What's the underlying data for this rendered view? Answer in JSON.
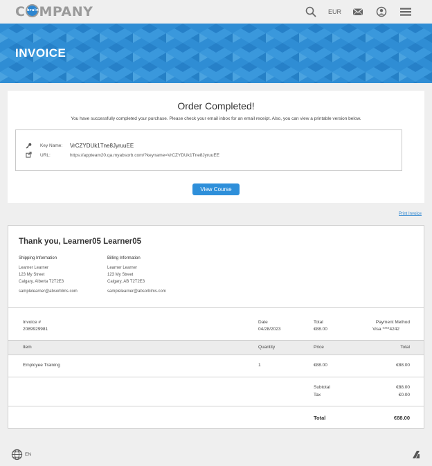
{
  "header": {
    "brand": "C",
    "brand_rest": "MPANY",
    "brand_badge": "brain",
    "currency": "EUR",
    "icons": [
      "search-icon",
      "mail-icon",
      "user-icon",
      "menu-icon"
    ]
  },
  "banner": {
    "title": "INVOICE",
    "color": "#2c8bd3"
  },
  "order": {
    "title": "Order Completed!",
    "message": "You have successfully completed your purchase. Please check your email inbox for an email receipt. Also, you can view a printable version below.",
    "key_name_label": "Key Name:",
    "key_name_value": "VrCZYDUk1Tne8JyruuEE",
    "url_label": "URL:",
    "url_value": "https://appteam20.qa.myabsorb.com/?keyname=VrCZYDUk1Tne8JyruuEE",
    "view_course_label": "View Course"
  },
  "print_invoice_label": "Print Invoice",
  "invoice": {
    "thanks": "Thank you, Learner05 Learner05",
    "shipping": {
      "heading": "Shipping Information",
      "lines": [
        "Learner Learner",
        "123 My Street",
        "Calgary, Alberta T2T2E3"
      ],
      "email": "samplelearner@absorblms.com"
    },
    "billing": {
      "heading": "Billing Information",
      "lines": [
        "Learner Learner",
        "123 My Street",
        "Calgary, AB T2T2E3"
      ],
      "email": "samplelearner@absorblms.com"
    },
    "summary": {
      "invoice_label": "Invoice #",
      "invoice_value": "2089929981",
      "date_label": "Date",
      "date_value": "04/28/2023",
      "total_label": "Total",
      "total_value": "€88.00",
      "payment_label": "Payment Method",
      "payment_value": "Visa ****4242"
    },
    "columns": {
      "item": "Item",
      "quantity": "Quantity",
      "price": "Price",
      "total": "Total"
    },
    "items": [
      {
        "item": "Employee Training",
        "quantity": "1",
        "price": "€88.00",
        "total": "€88.00"
      }
    ],
    "subtotal_label": "Subtotal",
    "subtotal_value": "€88.00",
    "tax_label": "Tax",
    "tax_value": "€0.00",
    "grand_total_label": "Total",
    "grand_total_value": "€88.00"
  },
  "footer": {
    "language": "EN"
  }
}
